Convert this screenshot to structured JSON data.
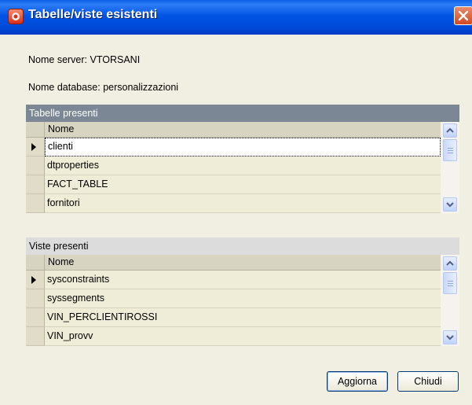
{
  "window": {
    "title": "Tabelle/viste esistenti",
    "accent": "#0054e3",
    "close_icon": "close-icon"
  },
  "info": {
    "server_line": "Nome server: VTORSANI",
    "database_line": "Nome database: personalizzazioni"
  },
  "tables_grid": {
    "caption": "Tabelle presenti",
    "column_header": "Nome",
    "rows": [
      "clienti",
      "dtproperties",
      "FACT_TABLE",
      "fornitori"
    ]
  },
  "views_grid": {
    "caption": "Viste presenti",
    "column_header": "Nome",
    "rows": [
      "sysconstraints",
      "syssegments",
      "VIN_PERCLIENTIROSSI",
      "VIN_provv"
    ]
  },
  "buttons": {
    "refresh_label": "Aggiorna",
    "close_label": "Chiudi"
  }
}
